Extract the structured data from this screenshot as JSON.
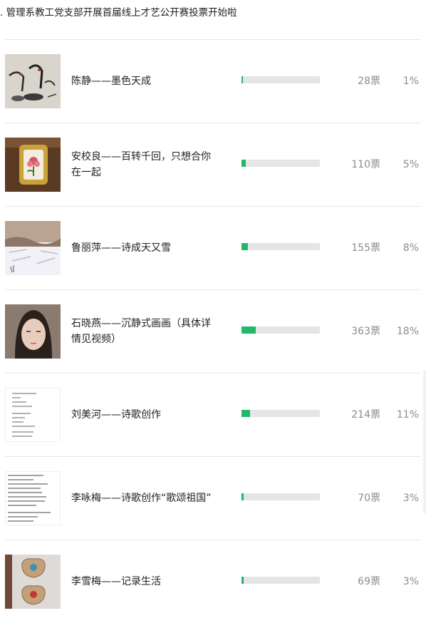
{
  "page": {
    "title": ". 管理系教工党支部开展首届线上才艺公开赛投票开始啦"
  },
  "entries": [
    {
      "name": "陈静——墨色天成",
      "votes": "28票",
      "percent": "1%",
      "ratio": 0.01,
      "thumb": "ink-painting-thumbnail"
    },
    {
      "name": "安校良——百转千回，只想合你在一起",
      "votes": "110票",
      "percent": "5%",
      "ratio": 0.05,
      "thumb": "framed-flower-thumbnail"
    },
    {
      "name": "鲁丽萍——诗成天又雪",
      "votes": "155票",
      "percent": "8%",
      "ratio": 0.08,
      "thumb": "snow-landscape-thumbnail"
    },
    {
      "name": "石晓燕——沉静式画画（具体详情见视频）",
      "votes": "363票",
      "percent": "18%",
      "ratio": 0.18,
      "thumb": "portrait-thumbnail"
    },
    {
      "name": "刘美河——诗歌创作",
      "votes": "214票",
      "percent": "11%",
      "ratio": 0.11,
      "thumb": "poem-text-thumbnail"
    },
    {
      "name": "李咏梅——诗歌创作“歌颂祖国”",
      "votes": "70票",
      "percent": "3%",
      "ratio": 0.03,
      "thumb": "handwritten-poem-thumbnail"
    },
    {
      "name": "李雪梅——记录生活",
      "votes": "69票",
      "percent": "3%",
      "ratio": 0.03,
      "thumb": "ornament-photo-thumbnail"
    }
  ],
  "colors": {
    "bar_fill": "#20b86a",
    "bar_track": "#e5e5e5",
    "muted_text": "#8c8c8c"
  }
}
